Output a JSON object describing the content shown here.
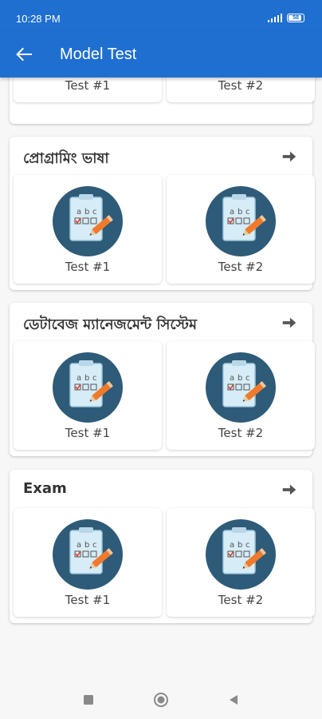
{
  "status_bar": {
    "time": "10:28 PM",
    "battery": "58"
  },
  "app_bar": {
    "title": "Model Test"
  },
  "sections": [
    {
      "title": "",
      "cards": [
        {
          "label": "Test #1"
        },
        {
          "label": "Test #2"
        }
      ]
    },
    {
      "title": "প্রোগ্রামিং ভাষা",
      "cards": [
        {
          "label": "Test #1"
        },
        {
          "label": "Test #2"
        }
      ]
    },
    {
      "title": "ডেটাবেজ ম্যানেজমেন্ট সিস্টেম",
      "cards": [
        {
          "label": "Test #1"
        },
        {
          "label": "Test #2"
        }
      ]
    },
    {
      "title": "Exam",
      "cards": [
        {
          "label": "Test #1"
        },
        {
          "label": "Test #2"
        }
      ]
    }
  ],
  "icons": {
    "back": "arrow-left-icon",
    "section_arrow": "arrow-right-icon",
    "test": "clipboard-checklist-icon"
  },
  "colors": {
    "primary": "#1f6fd0",
    "icon_circle": "#2e5b78",
    "pencil": "#f07a2a",
    "clipboard": "#d6ecf7"
  }
}
